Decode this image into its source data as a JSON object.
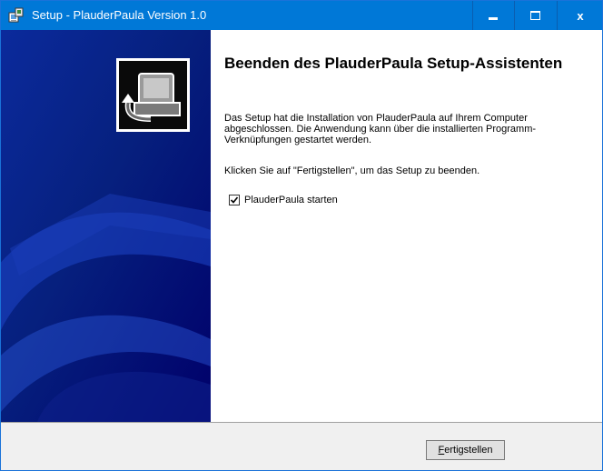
{
  "window": {
    "title": "Setup - PlauderPaula Version 1.0",
    "controls": {
      "minimize_icon": "minimize-icon",
      "maximize_icon": "maximize-icon",
      "close_icon": "close-icon",
      "close_glyph": "x"
    }
  },
  "colors": {
    "titlebar": "#0078d7",
    "sidebar_dark": "#00006a",
    "sidebar_mid": "#0b2a9c",
    "footer": "#f0f0f0"
  },
  "wizard": {
    "heading": "Beenden des PlauderPaula Setup-Assistenten",
    "paragraph1": "Das Setup hat die Installation von PlauderPaula auf Ihrem Computer abgeschlossen. Die Anwendung kann über die installierten Programm-Verknüpfungen gestartet werden.",
    "paragraph2": "Klicken Sie auf \"Fertigstellen\", um das Setup zu beenden.",
    "launch_checkbox": {
      "label": "PlauderPaula starten",
      "checked": true
    },
    "finish_button": {
      "accel": "F",
      "rest": "ertigstellen"
    }
  }
}
